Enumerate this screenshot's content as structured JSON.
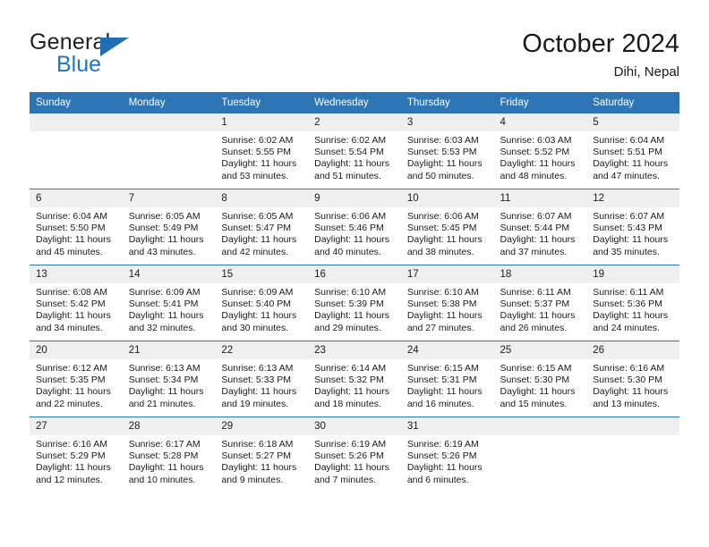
{
  "logo": {
    "word1": "General",
    "word2": "Blue",
    "triangle_color": "#1f6fb2",
    "word2_color": "#1f77bd"
  },
  "header": {
    "title": "October 2024",
    "subtitle": "Dihi, Nepal"
  },
  "theme": {
    "header_blue": "#2e75b6",
    "daynum_band": "#efefef",
    "text": "#1a1a1a"
  },
  "weekday_headers": [
    "Sunday",
    "Monday",
    "Tuesday",
    "Wednesday",
    "Thursday",
    "Friday",
    "Saturday"
  ],
  "labels": {
    "sunrise_prefix": "Sunrise:",
    "sunset_prefix": "Sunset:",
    "daylight_prefix": "Daylight:"
  },
  "weeks": [
    [
      {
        "day": "",
        "blank": true
      },
      {
        "day": "",
        "blank": true
      },
      {
        "day": "1",
        "sunrise": "Sunrise: 6:02 AM",
        "sunset": "Sunset: 5:55 PM",
        "daylight_1": "Daylight: 11 hours",
        "daylight_2": "and 53 minutes."
      },
      {
        "day": "2",
        "sunrise": "Sunrise: 6:02 AM",
        "sunset": "Sunset: 5:54 PM",
        "daylight_1": "Daylight: 11 hours",
        "daylight_2": "and 51 minutes."
      },
      {
        "day": "3",
        "sunrise": "Sunrise: 6:03 AM",
        "sunset": "Sunset: 5:53 PM",
        "daylight_1": "Daylight: 11 hours",
        "daylight_2": "and 50 minutes."
      },
      {
        "day": "4",
        "sunrise": "Sunrise: 6:03 AM",
        "sunset": "Sunset: 5:52 PM",
        "daylight_1": "Daylight: 11 hours",
        "daylight_2": "and 48 minutes."
      },
      {
        "day": "5",
        "sunrise": "Sunrise: 6:04 AM",
        "sunset": "Sunset: 5:51 PM",
        "daylight_1": "Daylight: 11 hours",
        "daylight_2": "and 47 minutes."
      }
    ],
    [
      {
        "day": "6",
        "sunrise": "Sunrise: 6:04 AM",
        "sunset": "Sunset: 5:50 PM",
        "daylight_1": "Daylight: 11 hours",
        "daylight_2": "and 45 minutes."
      },
      {
        "day": "7",
        "sunrise": "Sunrise: 6:05 AM",
        "sunset": "Sunset: 5:49 PM",
        "daylight_1": "Daylight: 11 hours",
        "daylight_2": "and 43 minutes."
      },
      {
        "day": "8",
        "sunrise": "Sunrise: 6:05 AM",
        "sunset": "Sunset: 5:47 PM",
        "daylight_1": "Daylight: 11 hours",
        "daylight_2": "and 42 minutes."
      },
      {
        "day": "9",
        "sunrise": "Sunrise: 6:06 AM",
        "sunset": "Sunset: 5:46 PM",
        "daylight_1": "Daylight: 11 hours",
        "daylight_2": "and 40 minutes."
      },
      {
        "day": "10",
        "sunrise": "Sunrise: 6:06 AM",
        "sunset": "Sunset: 5:45 PM",
        "daylight_1": "Daylight: 11 hours",
        "daylight_2": "and 38 minutes."
      },
      {
        "day": "11",
        "sunrise": "Sunrise: 6:07 AM",
        "sunset": "Sunset: 5:44 PM",
        "daylight_1": "Daylight: 11 hours",
        "daylight_2": "and 37 minutes."
      },
      {
        "day": "12",
        "sunrise": "Sunrise: 6:07 AM",
        "sunset": "Sunset: 5:43 PM",
        "daylight_1": "Daylight: 11 hours",
        "daylight_2": "and 35 minutes."
      }
    ],
    [
      {
        "day": "13",
        "sunrise": "Sunrise: 6:08 AM",
        "sunset": "Sunset: 5:42 PM",
        "daylight_1": "Daylight: 11 hours",
        "daylight_2": "and 34 minutes."
      },
      {
        "day": "14",
        "sunrise": "Sunrise: 6:09 AM",
        "sunset": "Sunset: 5:41 PM",
        "daylight_1": "Daylight: 11 hours",
        "daylight_2": "and 32 minutes."
      },
      {
        "day": "15",
        "sunrise": "Sunrise: 6:09 AM",
        "sunset": "Sunset: 5:40 PM",
        "daylight_1": "Daylight: 11 hours",
        "daylight_2": "and 30 minutes."
      },
      {
        "day": "16",
        "sunrise": "Sunrise: 6:10 AM",
        "sunset": "Sunset: 5:39 PM",
        "daylight_1": "Daylight: 11 hours",
        "daylight_2": "and 29 minutes."
      },
      {
        "day": "17",
        "sunrise": "Sunrise: 6:10 AM",
        "sunset": "Sunset: 5:38 PM",
        "daylight_1": "Daylight: 11 hours",
        "daylight_2": "and 27 minutes."
      },
      {
        "day": "18",
        "sunrise": "Sunrise: 6:11 AM",
        "sunset": "Sunset: 5:37 PM",
        "daylight_1": "Daylight: 11 hours",
        "daylight_2": "and 26 minutes."
      },
      {
        "day": "19",
        "sunrise": "Sunrise: 6:11 AM",
        "sunset": "Sunset: 5:36 PM",
        "daylight_1": "Daylight: 11 hours",
        "daylight_2": "and 24 minutes."
      }
    ],
    [
      {
        "day": "20",
        "sunrise": "Sunrise: 6:12 AM",
        "sunset": "Sunset: 5:35 PM",
        "daylight_1": "Daylight: 11 hours",
        "daylight_2": "and 22 minutes."
      },
      {
        "day": "21",
        "sunrise": "Sunrise: 6:13 AM",
        "sunset": "Sunset: 5:34 PM",
        "daylight_1": "Daylight: 11 hours",
        "daylight_2": "and 21 minutes."
      },
      {
        "day": "22",
        "sunrise": "Sunrise: 6:13 AM",
        "sunset": "Sunset: 5:33 PM",
        "daylight_1": "Daylight: 11 hours",
        "daylight_2": "and 19 minutes."
      },
      {
        "day": "23",
        "sunrise": "Sunrise: 6:14 AM",
        "sunset": "Sunset: 5:32 PM",
        "daylight_1": "Daylight: 11 hours",
        "daylight_2": "and 18 minutes."
      },
      {
        "day": "24",
        "sunrise": "Sunrise: 6:15 AM",
        "sunset": "Sunset: 5:31 PM",
        "daylight_1": "Daylight: 11 hours",
        "daylight_2": "and 16 minutes."
      },
      {
        "day": "25",
        "sunrise": "Sunrise: 6:15 AM",
        "sunset": "Sunset: 5:30 PM",
        "daylight_1": "Daylight: 11 hours",
        "daylight_2": "and 15 minutes."
      },
      {
        "day": "26",
        "sunrise": "Sunrise: 6:16 AM",
        "sunset": "Sunset: 5:30 PM",
        "daylight_1": "Daylight: 11 hours",
        "daylight_2": "and 13 minutes."
      }
    ],
    [
      {
        "day": "27",
        "sunrise": "Sunrise: 6:16 AM",
        "sunset": "Sunset: 5:29 PM",
        "daylight_1": "Daylight: 11 hours",
        "daylight_2": "and 12 minutes."
      },
      {
        "day": "28",
        "sunrise": "Sunrise: 6:17 AM",
        "sunset": "Sunset: 5:28 PM",
        "daylight_1": "Daylight: 11 hours",
        "daylight_2": "and 10 minutes."
      },
      {
        "day": "29",
        "sunrise": "Sunrise: 6:18 AM",
        "sunset": "Sunset: 5:27 PM",
        "daylight_1": "Daylight: 11 hours",
        "daylight_2": "and 9 minutes."
      },
      {
        "day": "30",
        "sunrise": "Sunrise: 6:19 AM",
        "sunset": "Sunset: 5:26 PM",
        "daylight_1": "Daylight: 11 hours",
        "daylight_2": "and 7 minutes."
      },
      {
        "day": "31",
        "sunrise": "Sunrise: 6:19 AM",
        "sunset": "Sunset: 5:26 PM",
        "daylight_1": "Daylight: 11 hours",
        "daylight_2": "and 6 minutes."
      },
      {
        "day": "",
        "blank": true
      },
      {
        "day": "",
        "blank": true
      }
    ]
  ]
}
